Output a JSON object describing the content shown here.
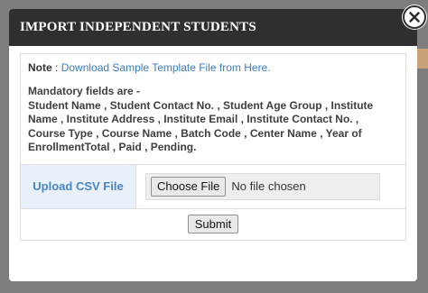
{
  "dialog": {
    "title": "IMPORT INDEPENDENT STUDENTS",
    "close_icon": "close-icon"
  },
  "note": {
    "label": "Note",
    "separator": " : ",
    "link_text": "Download Sample Template File from Here."
  },
  "mandatory": {
    "line1": "Mandatory fields are -",
    "line2": "Student Name , Student Contact No. , Student Age Group , Institute",
    "line3": "Name , Institute Address , Institute Email , Institute Contact No. ,",
    "line4": "Course Type , Course Name , Batch Code , Center Name , Year of",
    "line5": "EnrollmentTotal , Paid , Pending."
  },
  "upload": {
    "label": "Upload CSV File",
    "choose_button": "Choose File",
    "status": "No file chosen"
  },
  "submit_label": "Submit",
  "colors": {
    "header_bg": "#2f2f2f",
    "link": "#3a7dc0",
    "label_cell_bg": "#e8f1fa",
    "label_text": "#4a86c0"
  }
}
